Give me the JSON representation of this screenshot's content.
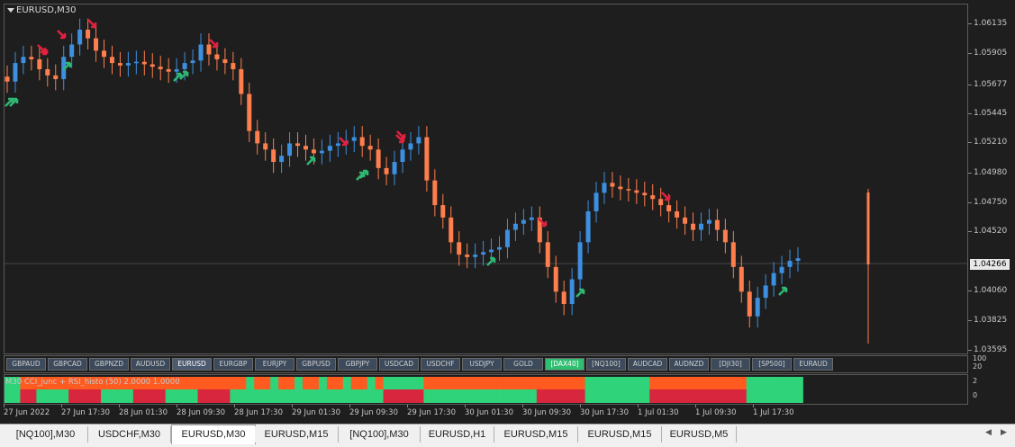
{
  "window": {
    "symbol": "EURUSD,M30",
    "current_price": "1.04266"
  },
  "price_axis": {
    "ticks": [
      "1.06135",
      "1.05905",
      "1.05677",
      "1.05445",
      "1.05210",
      "1.04980",
      "1.04750",
      "1.04520",
      "1.04060",
      "1.03825",
      "1.03595"
    ]
  },
  "symbol_buttons": [
    {
      "label": "GBPAUD",
      "state": "normal"
    },
    {
      "label": "GBPCAD",
      "state": "normal"
    },
    {
      "label": "GBPNZD",
      "state": "normal"
    },
    {
      "label": "AUDUSD",
      "state": "normal"
    },
    {
      "label": "EURUSD",
      "state": "active"
    },
    {
      "label": "EURGBP",
      "state": "normal"
    },
    {
      "label": "EURJPY",
      "state": "normal"
    },
    {
      "label": "GBPUSD",
      "state": "normal"
    },
    {
      "label": "GBPJPY",
      "state": "normal"
    },
    {
      "label": "USDCAD",
      "state": "normal"
    },
    {
      "label": "USDCHF",
      "state": "normal"
    },
    {
      "label": "USDJPY",
      "state": "normal"
    },
    {
      "label": "GOLD",
      "state": "normal"
    },
    {
      "label": "[DAX40]",
      "state": "green"
    },
    {
      "label": "[NQ100]",
      "state": "normal"
    },
    {
      "label": "AUDCAD",
      "state": "normal"
    },
    {
      "label": "AUDNZD",
      "state": "normal"
    },
    {
      "label": "[DJI30]",
      "state": "normal"
    },
    {
      "label": "[SP500]",
      "state": "normal"
    },
    {
      "label": "EURAUD",
      "state": "normal"
    }
  ],
  "symbol_axis": {
    "top": "100",
    "bottom": "20"
  },
  "indicator": {
    "label": "M30  CCI_junc + RSI_histo (50) 2.0000 1.0000",
    "axis_top": "2",
    "axis_bottom": "0"
  },
  "time_axis": {
    "ticks": [
      "27 Jun 2022",
      "27 Jun 17:30",
      "28 Jun 01:30",
      "28 Jun 09:30",
      "28 Jun 17:30",
      "29 Jun 01:30",
      "29 Jun 09:30",
      "29 Jun 17:30",
      "30 Jun 01:30",
      "30 Jun 09:30",
      "30 Jun 17:30",
      "1 Jul 01:30",
      "1 Jul 09:30",
      "1 Jul 17:30"
    ]
  },
  "tabs": [
    {
      "label": "[NQ100],M30",
      "active": false
    },
    {
      "label": "USDCHF,M30",
      "active": false
    },
    {
      "label": "EURUSD,M30",
      "active": true
    },
    {
      "label": "EURUSD,M15",
      "active": false
    },
    {
      "label": "[NQ100],M30",
      "active": false
    },
    {
      "label": "EURUSD,H1",
      "active": false
    },
    {
      "label": "EURUSD,M15",
      "active": false
    },
    {
      "label": "EURUSD,M15",
      "active": false
    },
    {
      "label": "EURUSD,M5",
      "active": false
    }
  ],
  "tab_arrows": {
    "left": "◀",
    "right": "▶"
  },
  "colors": {
    "bull": "#3d8fe0",
    "bear": "#ff7e4d",
    "arrow_up": "#2eb872",
    "arrow_down": "#e0213f",
    "histo_green": "#2fd37a",
    "histo_red": "#d7263d",
    "histo_orange": "#ff5a1f"
  },
  "chart_data": {
    "type": "candlestick",
    "series": [
      {
        "name": "EURUSD,M30",
        "close": [
          1.057,
          1.0585,
          1.059,
          1.0588,
          1.058,
          1.0575,
          1.0572,
          1.059,
          1.06,
          1.0612,
          1.0605,
          1.0595,
          1.059,
          1.0585,
          1.0583,
          1.0585,
          1.0586,
          1.0584,
          1.0582,
          1.058,
          1.0578,
          1.058,
          1.0585,
          1.0587,
          1.06,
          1.0592,
          1.0588,
          1.0585,
          1.058,
          1.056,
          1.053,
          1.052,
          1.0515,
          1.0505,
          1.051,
          1.052,
          1.0518,
          1.0515,
          1.0512,
          1.0514,
          1.0518,
          1.052,
          1.0522,
          1.0525,
          1.0518,
          1.0515,
          1.05,
          1.0495,
          1.0505,
          1.0515,
          1.052,
          1.0525,
          1.049,
          1.047,
          1.046,
          1.044,
          1.043,
          1.0428,
          1.043,
          1.0432,
          1.0434,
          1.0436,
          1.045,
          1.0455,
          1.0458,
          1.046,
          1.044,
          1.042,
          1.04,
          1.039,
          1.041,
          1.044,
          1.0465,
          1.048,
          1.0488,
          1.0485,
          1.0483,
          1.0482,
          1.048,
          1.0478,
          1.0475,
          1.047,
          1.0465,
          1.046,
          1.0455,
          1.045,
          1.0455,
          1.0458,
          1.045,
          1.044,
          1.042,
          1.04,
          1.038,
          1.0395,
          1.0405,
          1.0415,
          1.042,
          1.0425,
          1.0427
        ]
      }
    ],
    "up_arrows": 11,
    "down_arrows": 10
  }
}
